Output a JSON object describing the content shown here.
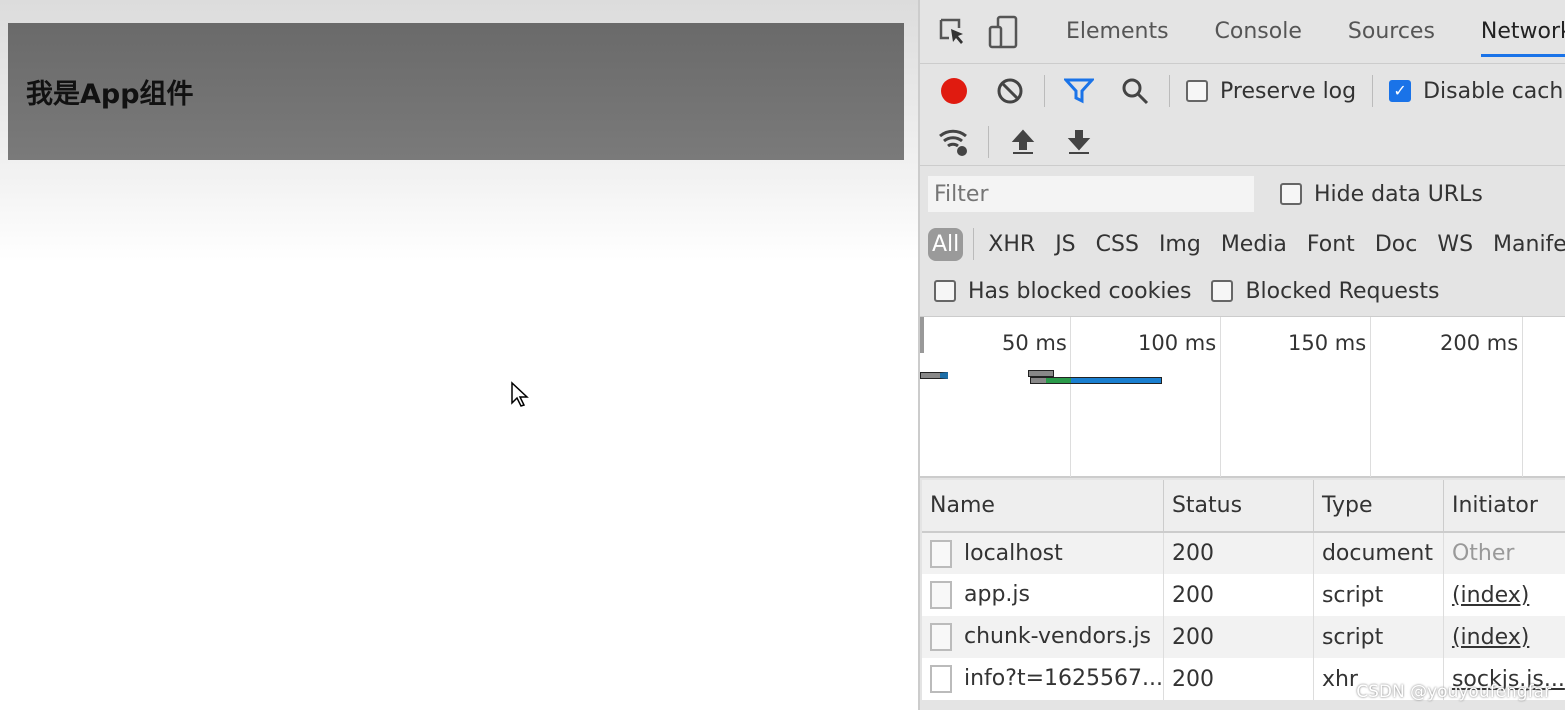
{
  "app": {
    "heading": "我是App组件"
  },
  "devtools": {
    "tabs": [
      "Elements",
      "Console",
      "Sources",
      "Network"
    ],
    "active_tab": "Network",
    "toolbar": {
      "preserve_log": "Preserve log",
      "preserve_log_checked": false,
      "disable_cache": "Disable cach",
      "disable_cache_checked": true,
      "record_color": "#e01b10"
    },
    "filter": {
      "placeholder": "Filter",
      "hide_data_urls": "Hide data URLs"
    },
    "types": [
      "All",
      "XHR",
      "JS",
      "CSS",
      "Img",
      "Media",
      "Font",
      "Doc",
      "WS",
      "Manifes"
    ],
    "active_type": "All",
    "blocked_cookies": "Has blocked cookies",
    "blocked_requests": "Blocked Requests",
    "timeline": {
      "ticks": [
        "50 ms",
        "100 ms",
        "150 ms",
        "200 ms"
      ]
    },
    "table": {
      "headers": [
        "Name",
        "Status",
        "Type",
        "Initiator"
      ],
      "rows": [
        {
          "name": "localhost",
          "status": "200",
          "type": "document",
          "initiator": "Other"
        },
        {
          "name": "app.js",
          "status": "200",
          "type": "script",
          "initiator": "(index)"
        },
        {
          "name": "chunk-vendors.js",
          "status": "200",
          "type": "script",
          "initiator": "(index)"
        },
        {
          "name": "info?t=1625567...",
          "status": "200",
          "type": "xhr",
          "initiator": "sockjs.js..."
        }
      ]
    }
  },
  "watermark": "CSDN @youyoufengfar"
}
